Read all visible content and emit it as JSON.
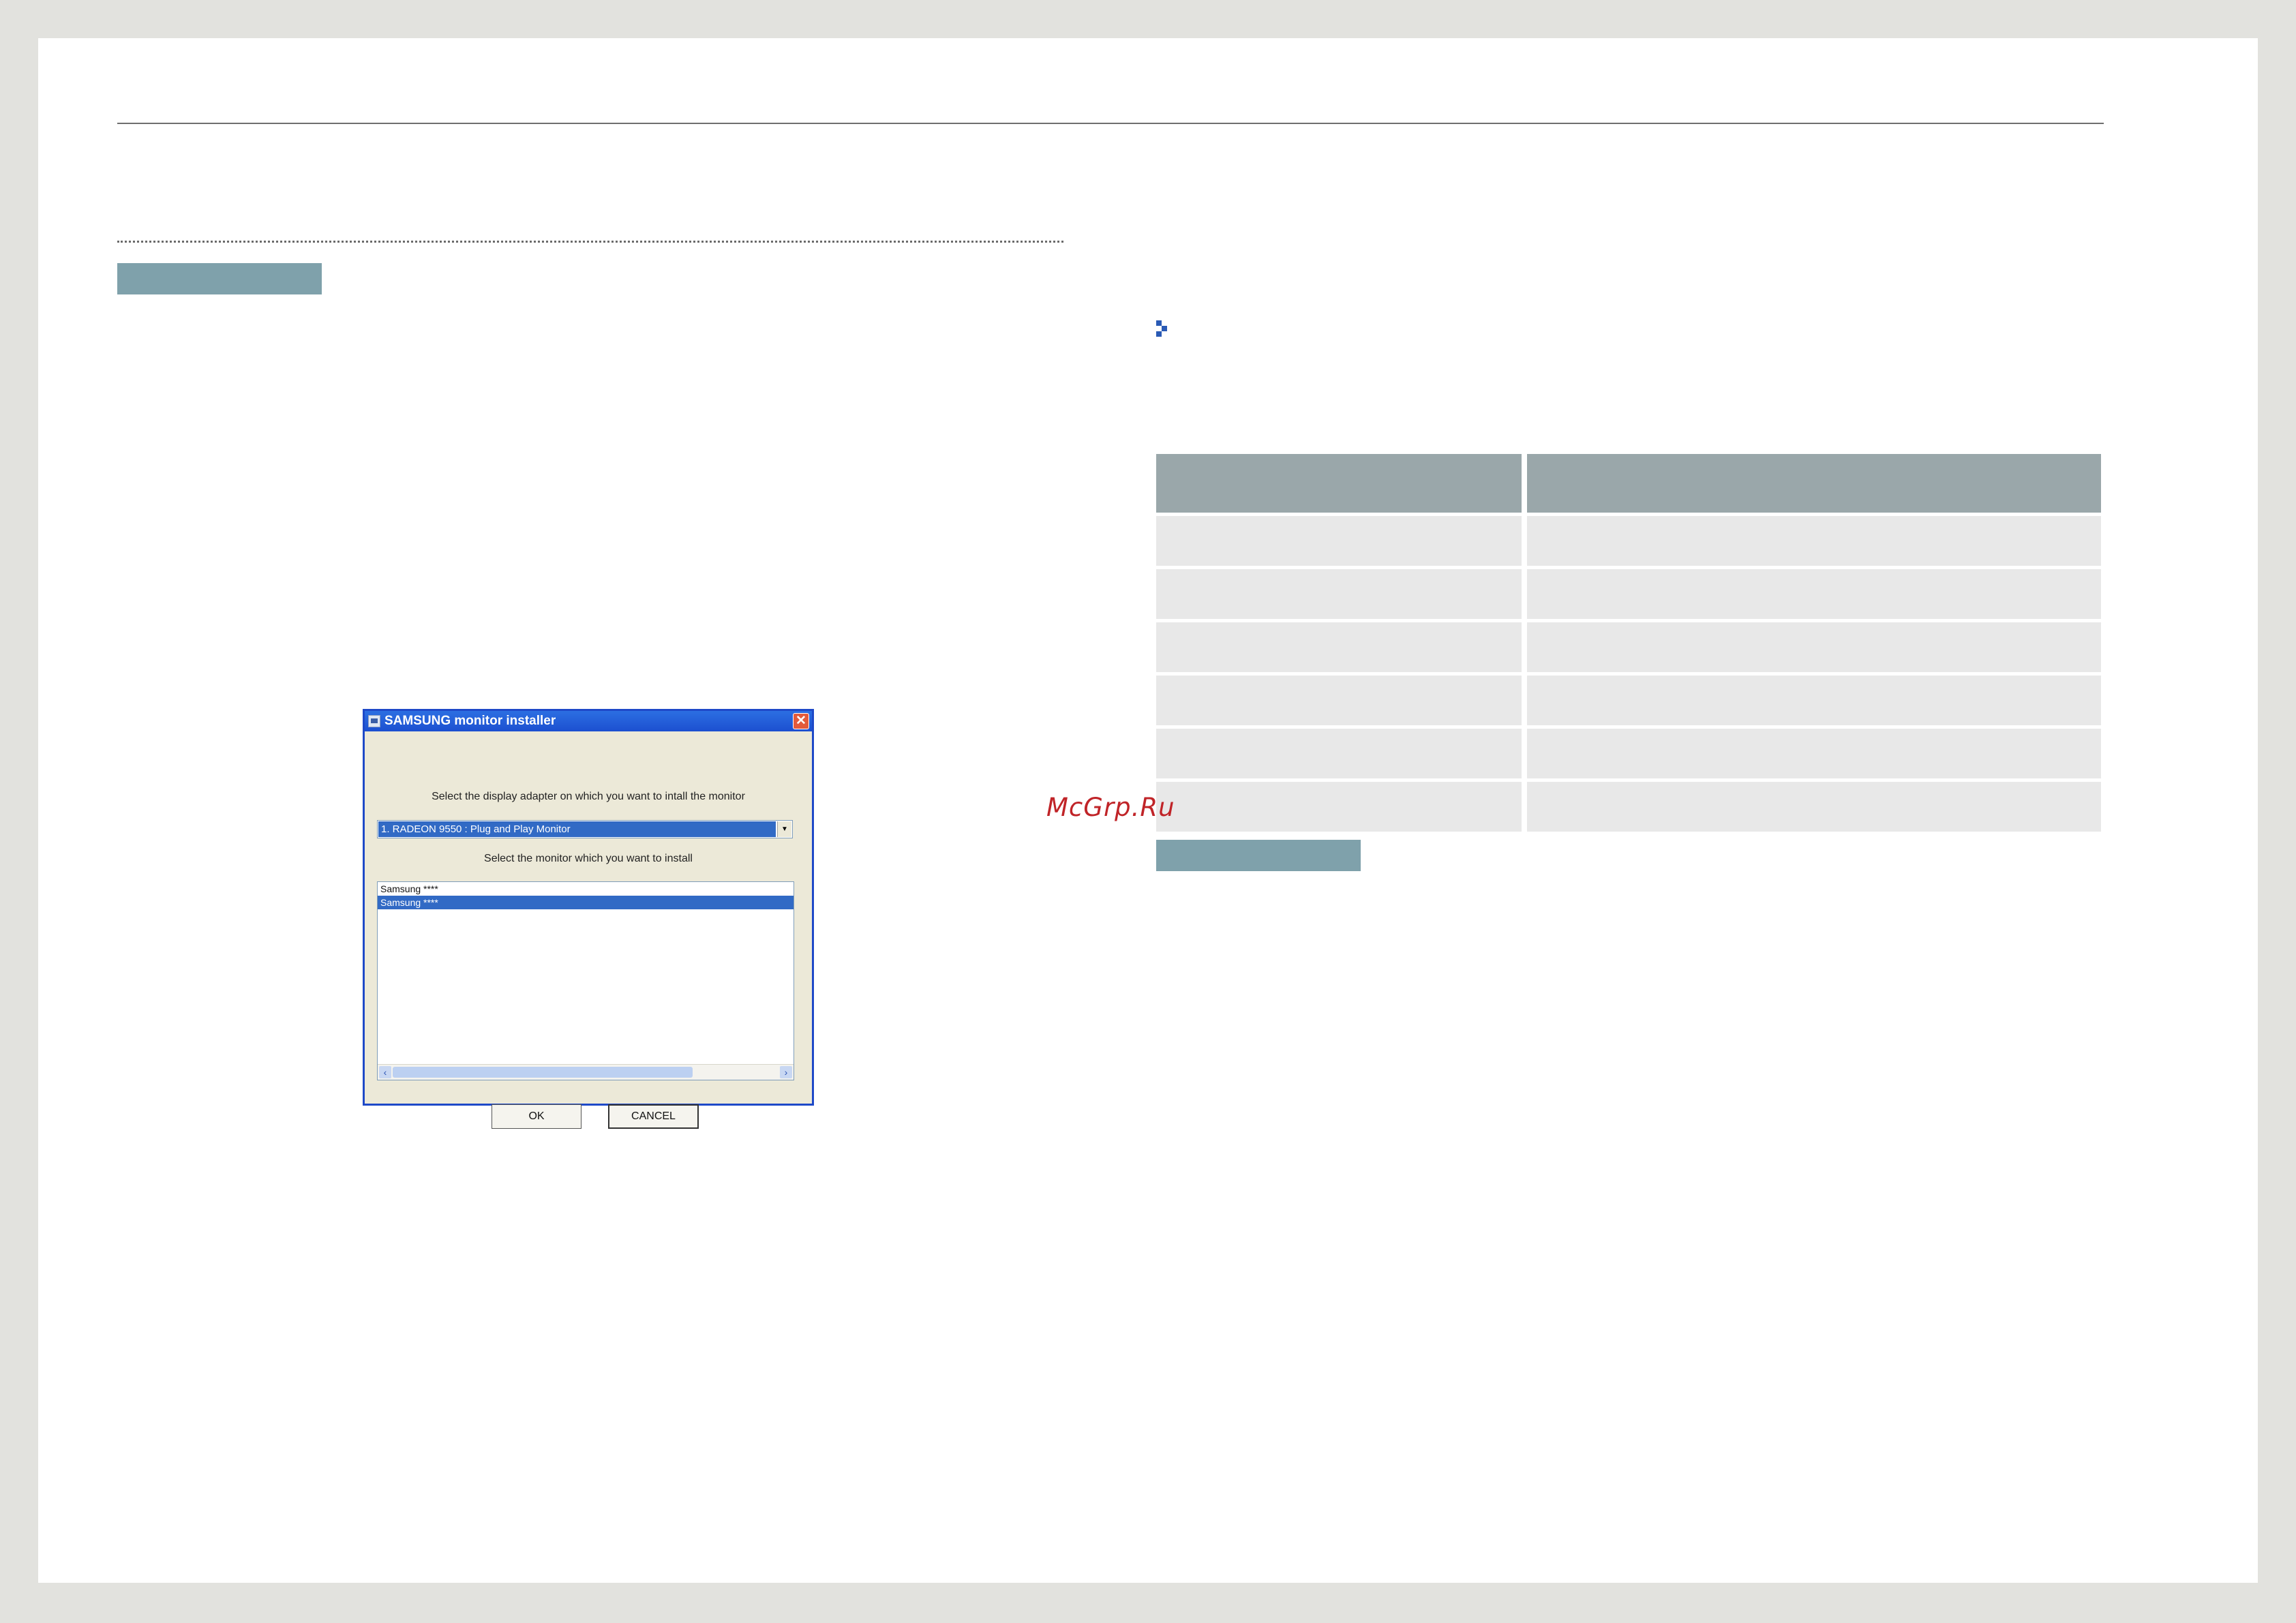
{
  "watermark": "McGrp.Ru",
  "dialog": {
    "title": "SAMSUNG monitor installer",
    "close_glyph": "✕",
    "adapter_prompt": "Select the display adapter on which you want to intall the monitor",
    "adapter_selected": "1. RADEON 9550 : Plug and Play Monitor",
    "monitor_prompt": "Select the monitor which you want to install",
    "monitors": [
      {
        "label": "Samsung ****",
        "selected": false
      },
      {
        "label": "Samsung ****",
        "selected": true
      }
    ],
    "ok_label": "OK",
    "cancel_label": "CANCEL"
  },
  "icons": {
    "bullet": "bullet-icon",
    "title": "monitor-icon",
    "close": "close-icon",
    "dropdown": "chevron-down-icon"
  },
  "colors": {
    "tag_bar": "#7fa1ab",
    "table_header": "#9aa7aa",
    "table_row": "#e8e8e8",
    "bullet": "#2a5ab5",
    "watermark": "#c02428"
  },
  "table": {
    "columns": 2,
    "rows": 6
  }
}
